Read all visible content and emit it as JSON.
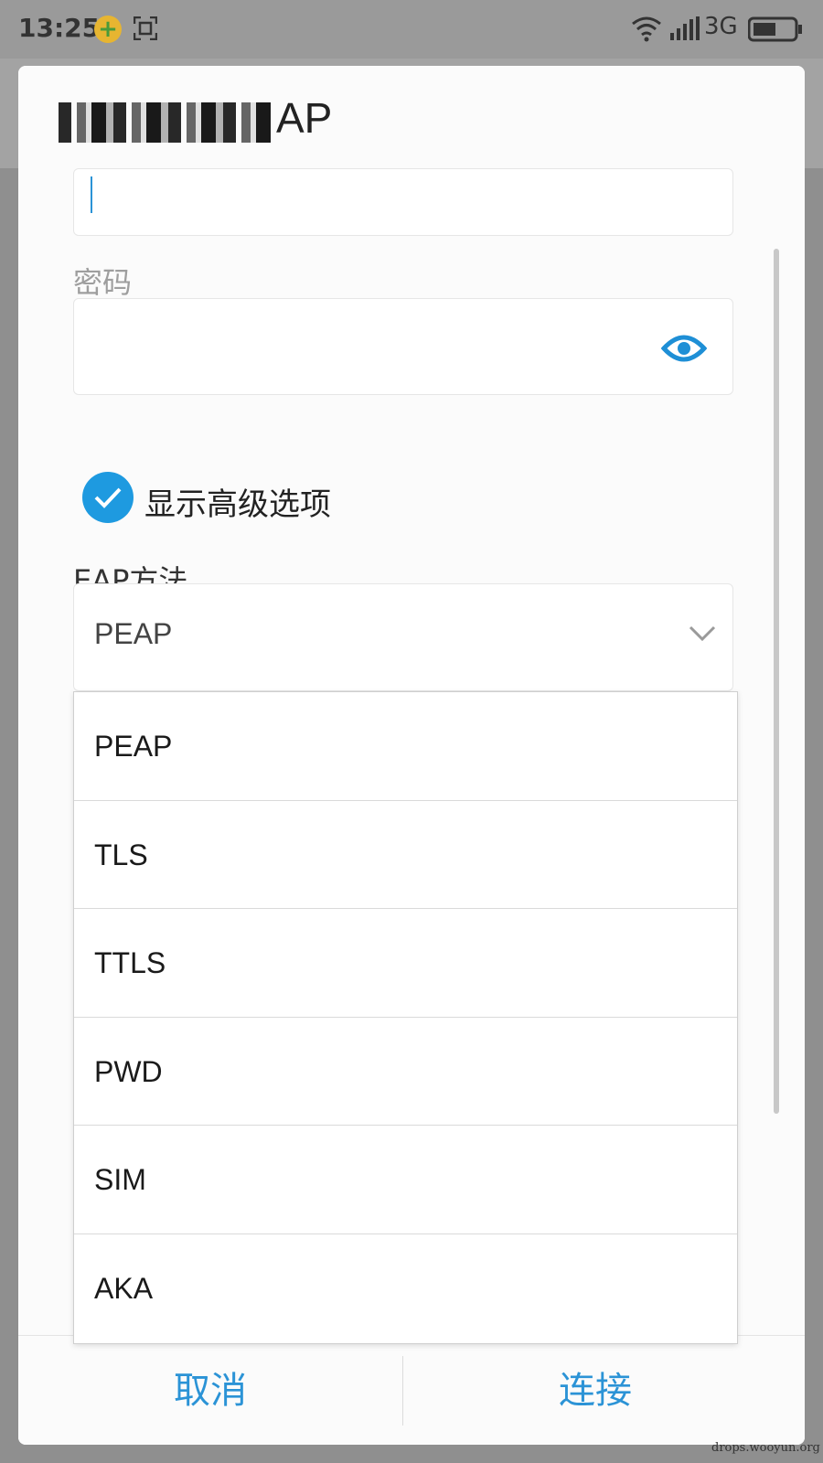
{
  "status_bar": {
    "time": "13:25",
    "network": "3G",
    "icons": [
      "app-notification-icon",
      "screenshot-icon",
      "wifi-icon",
      "signal-icon",
      "battery-icon"
    ]
  },
  "dialog": {
    "title": "AP",
    "password_label": "密码",
    "show_advanced_label": "显示高级选项",
    "show_advanced_checked": true,
    "eap_label": "EAP方法",
    "eap_selected": "PEAP",
    "eap_options": [
      "PEAP",
      "TLS",
      "TTLS",
      "PWD",
      "SIM",
      "AKA"
    ],
    "cancel_label": "取消",
    "connect_label": "连接"
  },
  "colors": {
    "accent": "#2b93d6",
    "check": "#1e9ae0"
  },
  "watermark": "drops.wooyun.org"
}
